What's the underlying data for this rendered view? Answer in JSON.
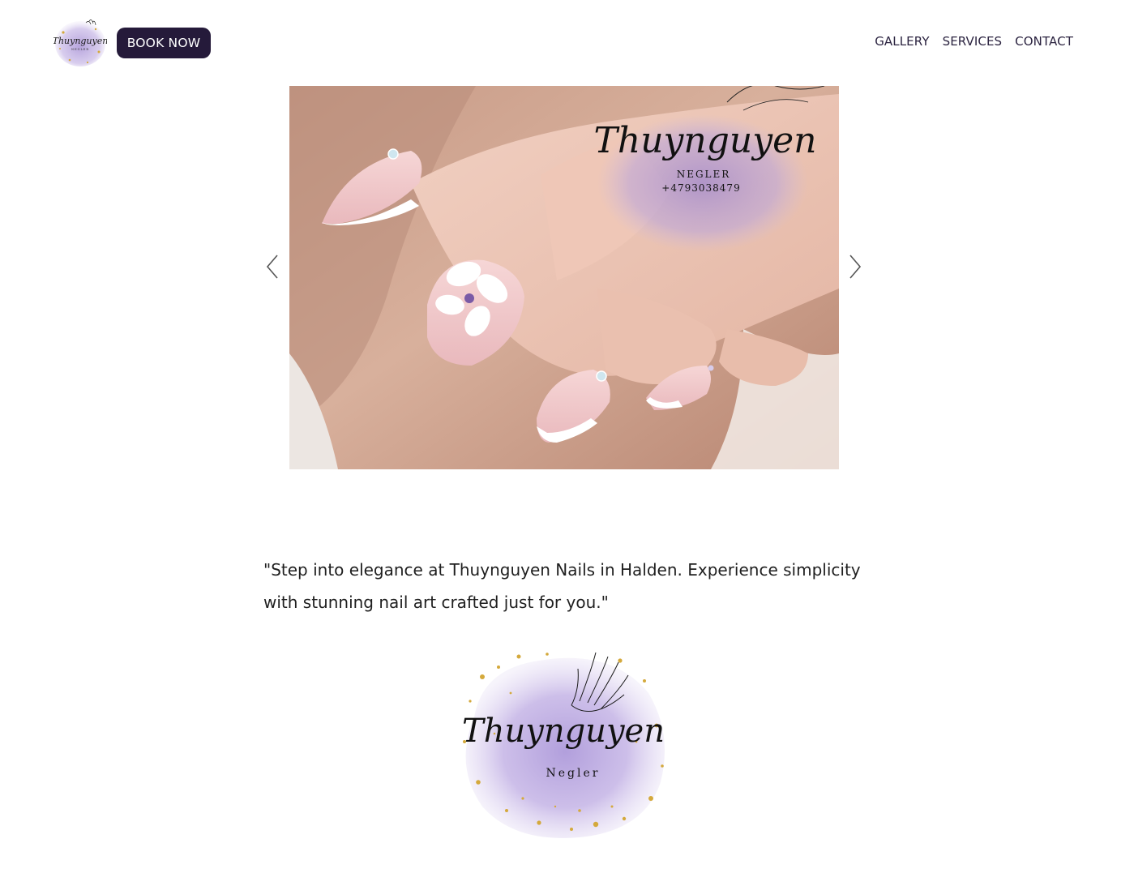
{
  "header": {
    "logo_text": "Thuynguyen",
    "logo_subtext": "NEGLER",
    "book_label": "BOOK NOW",
    "nav": [
      {
        "label": "GALLERY"
      },
      {
        "label": "SERVICES"
      },
      {
        "label": "CONTACT"
      }
    ]
  },
  "slideshow": {
    "brand_name": "Thuynguyen",
    "brand_sub": "NEGLER",
    "phone": "+4793038479",
    "prev_icon": "chevron-left-icon",
    "next_icon": "chevron-right-icon"
  },
  "main": {
    "tagline": "\"Step into elegance at Thuynguyen Nails in Halden. Experience simplicity with stunning nail art crafted just for you.\""
  },
  "footer_logo": {
    "brand_name": "Thuynguyen",
    "brand_sub": "Negler"
  },
  "colors": {
    "book_button_bg": "#251a3a",
    "nav_text": "#2b2340",
    "brand_lavender": "#b9a6dc",
    "brand_gold": "#d4a93c"
  }
}
